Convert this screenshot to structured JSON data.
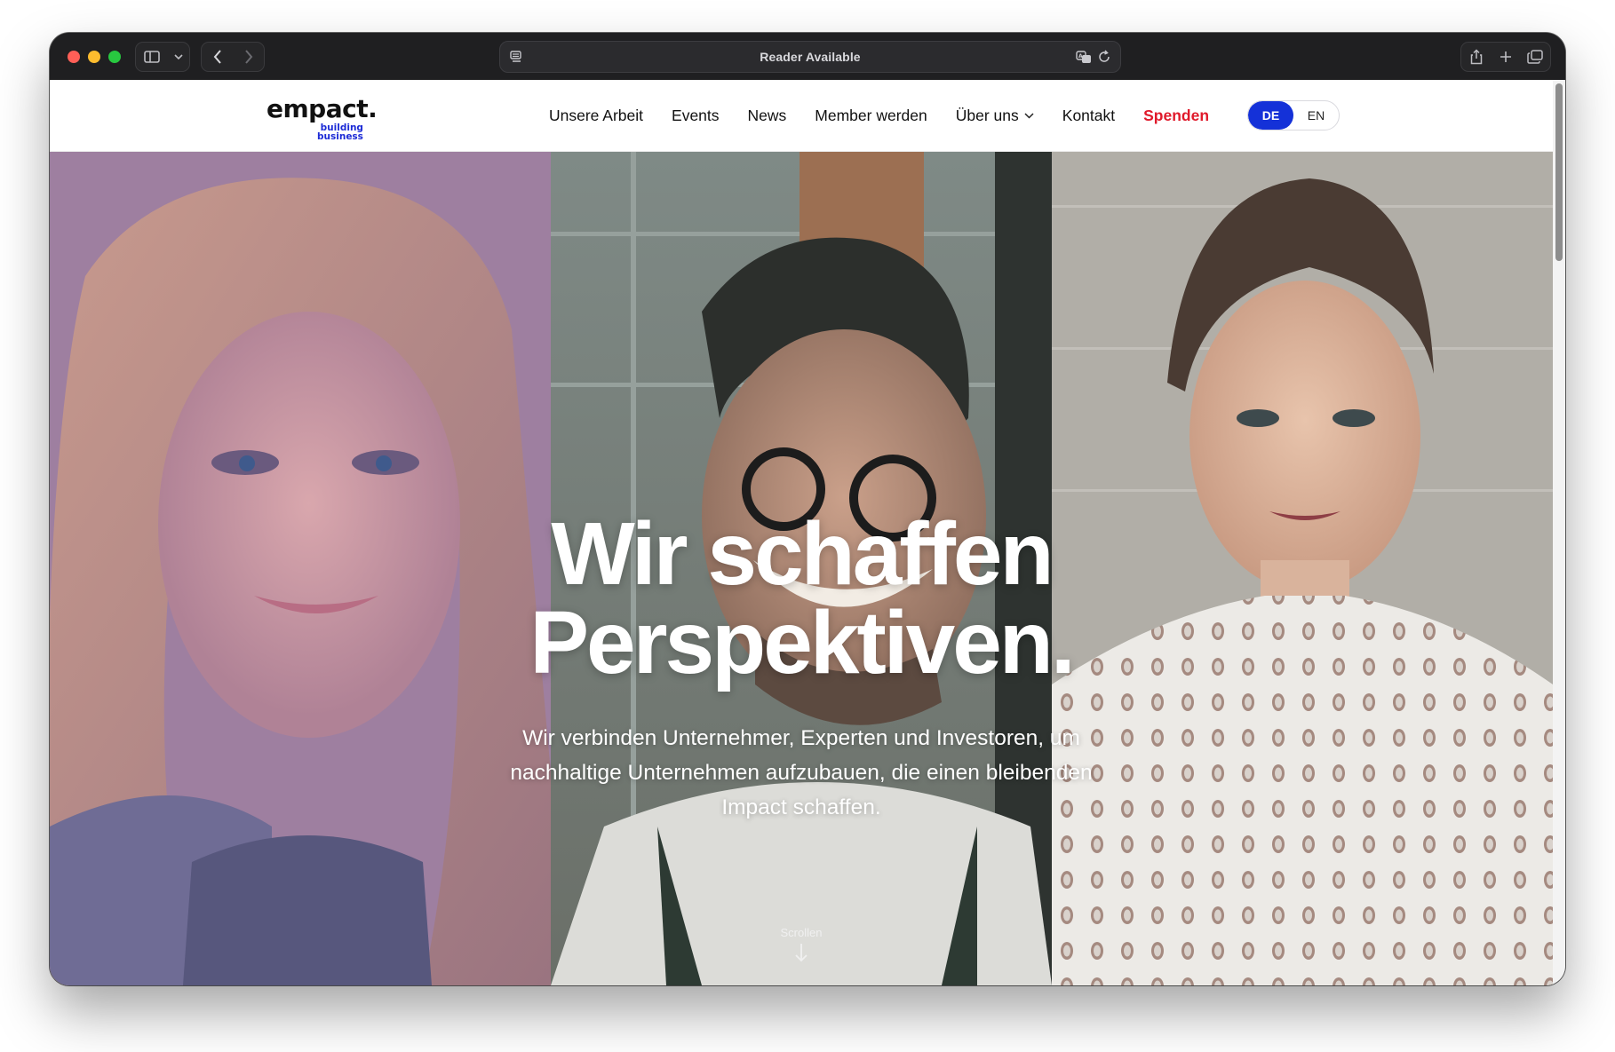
{
  "browser": {
    "address_text": "Reader Available",
    "icons": [
      "sidebar-icon",
      "chevron-down-icon",
      "back-icon",
      "forward-icon",
      "reader-icon",
      "translate-icon",
      "reload-icon",
      "share-icon",
      "new-tab-icon",
      "tabs-overview-icon"
    ]
  },
  "site": {
    "logo": {
      "main": "empact.",
      "sub_line1": "building",
      "sub_line2": "business",
      "accent": "#1c2bd6"
    },
    "nav": {
      "items": [
        {
          "label": "Unsere Arbeit"
        },
        {
          "label": "Events"
        },
        {
          "label": "News"
        },
        {
          "label": "Member werden"
        },
        {
          "label": "Über uns"
        },
        {
          "label": "Kontakt"
        },
        {
          "label": "Spenden"
        }
      ],
      "donate_color": "#e01a2b"
    },
    "language": {
      "de": "DE",
      "en": "EN",
      "active": "DE",
      "active_color": "#1431d8"
    }
  },
  "hero": {
    "headline_line1": "Wir schaffen",
    "headline_line2": "Perspektiven.",
    "subline_line1": "Wir verbinden Unternehmer, Experten und Investoren, um",
    "subline_line2": "nachhaltige Unternehmen aufzubauen, die einen bleibenden",
    "subline_line3": "Impact schaffen.",
    "scroll_label": "Scrollen"
  }
}
